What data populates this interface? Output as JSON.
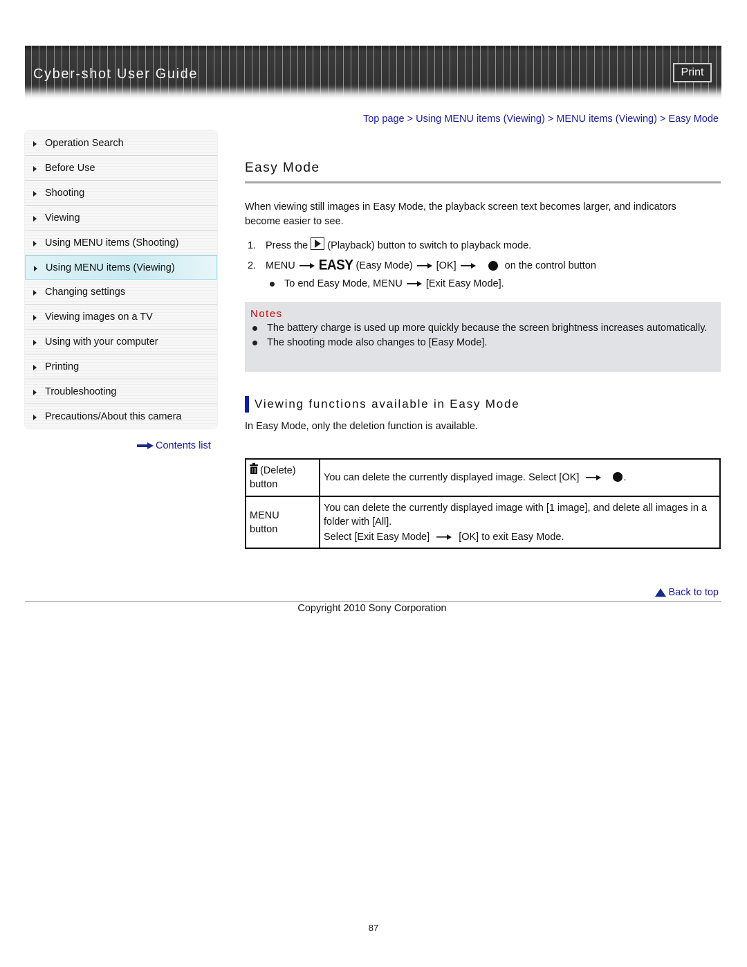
{
  "header": {
    "title": "Cyber-shot User Guide",
    "print_label": "Print"
  },
  "sidebar": {
    "items": [
      {
        "label": "Operation Search",
        "active": false
      },
      {
        "label": "Before Use",
        "active": false
      },
      {
        "label": "Shooting",
        "active": false
      },
      {
        "label": "Viewing",
        "active": false
      },
      {
        "label": "Using MENU items (Shooting)",
        "active": false
      },
      {
        "label": "Using MENU items (Viewing)",
        "active": true
      },
      {
        "label": "Changing settings",
        "active": false
      },
      {
        "label": "Viewing images on a TV",
        "active": false
      },
      {
        "label": "Using with your computer",
        "active": false
      },
      {
        "label": "Printing",
        "active": false
      },
      {
        "label": "Troubleshooting",
        "active": false
      },
      {
        "label": "Precautions/About this camera",
        "active": false
      }
    ],
    "contents_link": "Contents list"
  },
  "breadcrumb": {
    "items": [
      "Top page",
      "Using MENU items (Viewing)",
      "MENU items (Viewing)",
      "Easy Mode"
    ],
    "separator": ">"
  },
  "main": {
    "title": "Easy Mode",
    "intro": "When viewing still images in Easy Mode, the playback screen text becomes larger, and indicators become easier to see.",
    "steps": {
      "step1": {
        "num": "1.",
        "before": "Press the",
        "icon": "playback-icon",
        "after": "(Playback) button to switch to playback mode."
      },
      "step2": {
        "num": "2.",
        "menu": "MENU",
        "easy_icon": "EASY",
        "easy_label": "(Easy Mode)",
        "ok": "[OK]",
        "tail": "on the control button"
      },
      "sub": {
        "text1": "To end Easy Mode, MENU",
        "text2": "[Exit Easy Mode]."
      }
    },
    "notes": {
      "title": "Notes",
      "items": [
        "The battery charge is used up more quickly because the screen brightness increases automatically.",
        "The shooting mode also changes to [Easy Mode]."
      ]
    },
    "section": {
      "title": "Viewing functions available in Easy Mode",
      "intro": "In Easy Mode, only the deletion function is available."
    },
    "table": {
      "rows": [
        {
          "c1_line1": "(Delete)",
          "c1_line2": "button",
          "c2_text": "You can delete the currently displayed image. Select [OK]",
          "c2_end": "."
        },
        {
          "c1_line1": "MENU",
          "c1_line2": "button",
          "c2_line1": "You can delete the currently displayed image with [1 image], and delete all images in a folder with [All].",
          "c2_line2a": "Select [Exit Easy Mode]",
          "c2_line2b": "[OK] to exit Easy Mode."
        }
      ]
    }
  },
  "footer": {
    "back_to_top": "Back to top",
    "copyright": "Copyright 2010 Sony Corporation",
    "page_number": "87"
  },
  "colors": {
    "link": "#1a1aa8",
    "notes_title": "#cc0000",
    "notes_bg": "#e1e2e6",
    "section_bar": "#0f1fa3",
    "active_nav": "#c8eaf1"
  }
}
